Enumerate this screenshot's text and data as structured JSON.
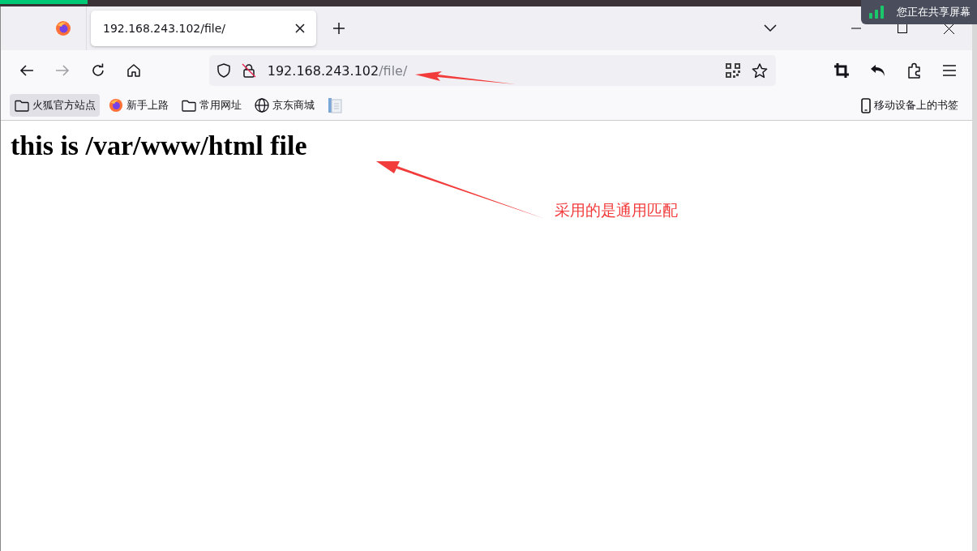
{
  "progress": {
    "level": 0.09
  },
  "tabs": [
    {
      "title": "192.168.243.102/file/",
      "selected": true
    }
  ],
  "address": {
    "host": "192.168.243.102",
    "path": "/file/"
  },
  "bookmarks": [
    {
      "kind": "folder",
      "label": "火狐官方站点",
      "selected": true
    },
    {
      "kind": "firefox",
      "label": "新手上路",
      "selected": false
    },
    {
      "kind": "folder",
      "label": "常用网址",
      "selected": false
    },
    {
      "kind": "globe",
      "label": "京东商城",
      "selected": false
    },
    {
      "kind": "doc",
      "selected": false
    }
  ],
  "mobile_bookmarks": "移动设备上的书签",
  "page": {
    "heading": "this is /var/www/html file"
  },
  "annotation": "采用的是通用匹配",
  "share_notice": "您正在共享屏幕"
}
